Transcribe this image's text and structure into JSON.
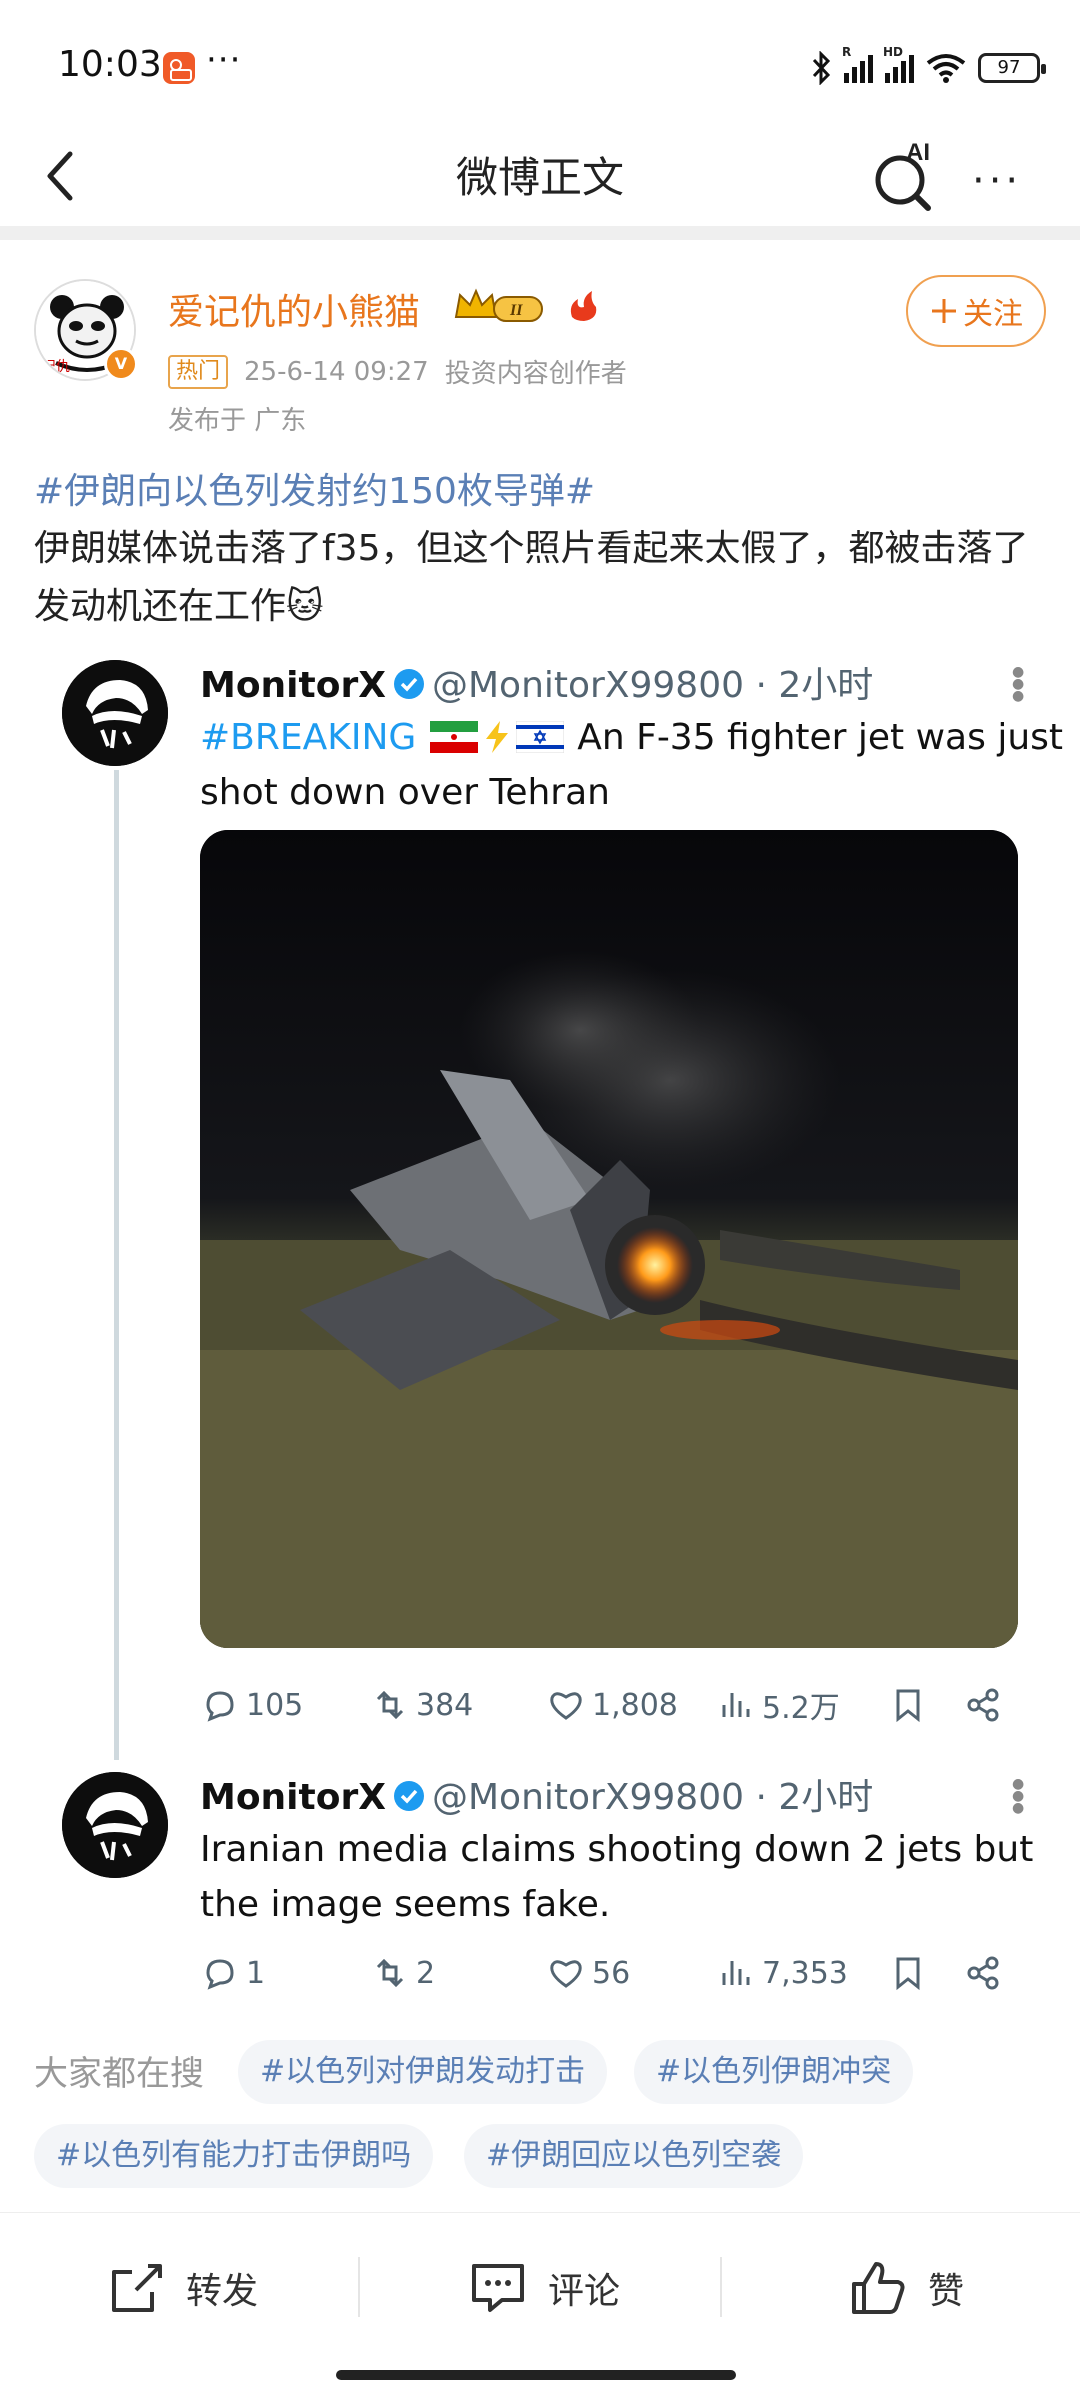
{
  "status_bar": {
    "time": "10:03",
    "dots": "···",
    "battery": "97",
    "signal1_label": "R",
    "signal2_label": "HD"
  },
  "header": {
    "title": "微博正文",
    "ai_label": "AI",
    "more": "···"
  },
  "post": {
    "author": {
      "name": "爱记仇的小熊猫",
      "badge": "热门",
      "date": "25-6-14 09:27",
      "role": "投资内容创作者",
      "location": "发布于 广东",
      "follow_label": "关注",
      "avatar_text": "记仇",
      "verified_mark": "V",
      "crown_level": "II"
    },
    "topic": "#伊朗向以色列发射约150枚导弹#",
    "text": "伊朗媒体说击落了f35，但这个照片看起来太假了，都被击落了发动机还在工作",
    "emoji": "🐱"
  },
  "tweets": [
    {
      "name": "MonitorX",
      "handle": "@MonitorX99800",
      "time": "· 2小时",
      "tag": "#BREAKING",
      "text": "An F-35 fighter jet was just shot down over Tehran",
      "stats": {
        "replies": "105",
        "retweets": "384",
        "likes": "1,808",
        "views": "5.2万"
      }
    },
    {
      "name": "MonitorX",
      "handle": "@MonitorX99800",
      "time": "· 2小时",
      "text": "Iranian media claims shooting down 2 jets but the image seems fake.",
      "stats": {
        "replies": "1",
        "retweets": "2",
        "likes": "56",
        "views": "7,353"
      }
    }
  ],
  "hot_search": {
    "label": "大家都在搜",
    "chips": [
      "#以色列对伊朗发动打击",
      "#以色列伊朗冲突",
      "#以色列有能力打击伊朗吗",
      "#伊朗回应以色列空袭"
    ]
  },
  "bottom_bar": {
    "repost": "转发",
    "comment": "评论",
    "like": "赞"
  },
  "colors": {
    "accent_orange": "#e8761d",
    "topic_blue": "#5a7fb5",
    "twitter_blue": "#1d9bf0"
  }
}
